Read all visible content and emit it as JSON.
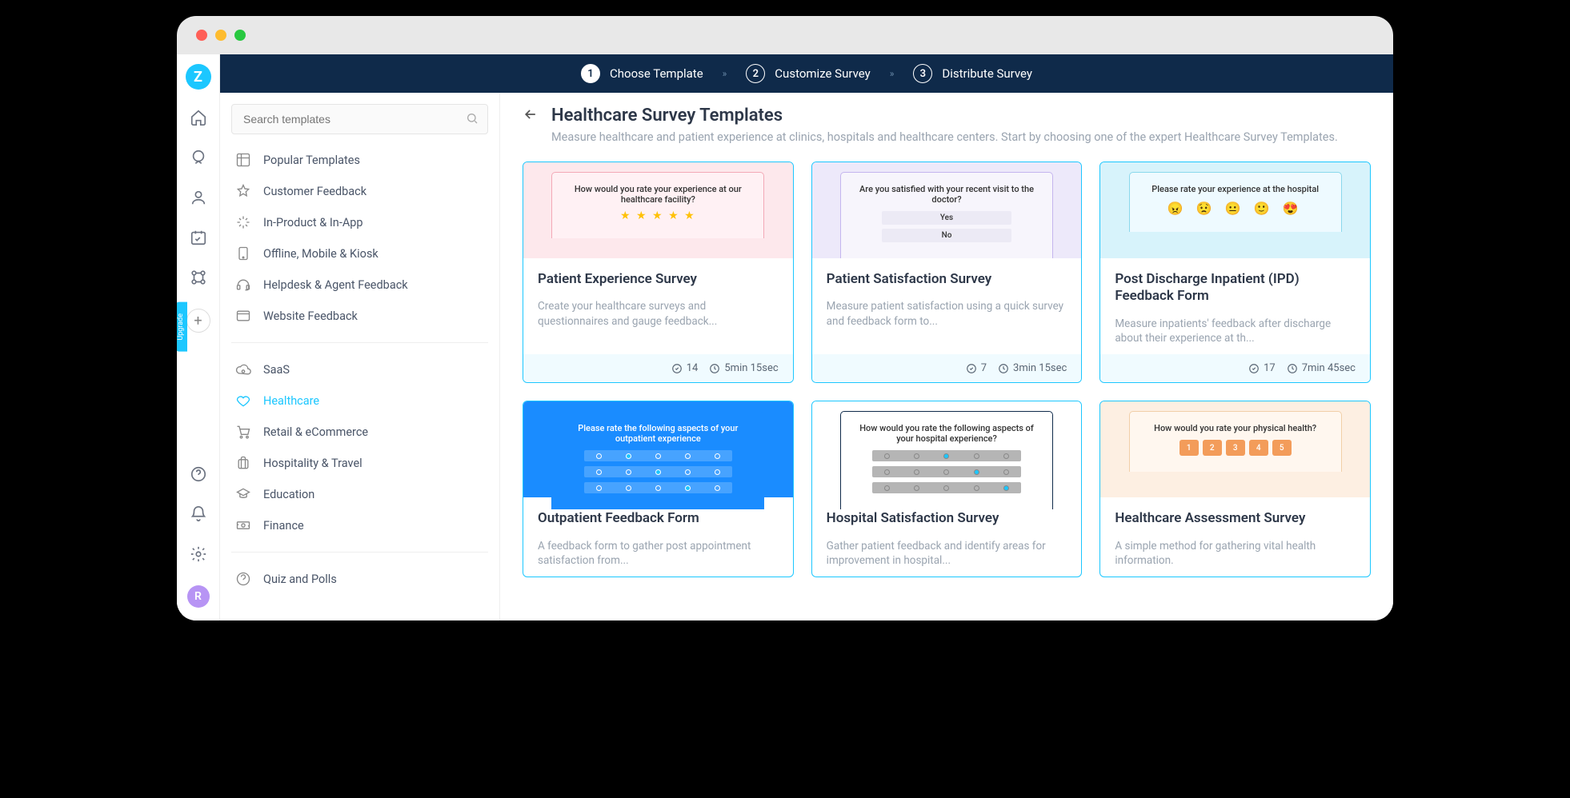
{
  "stepper": {
    "steps": [
      {
        "num": "1",
        "label": "Choose Template",
        "active": true
      },
      {
        "num": "2",
        "label": "Customize Survey",
        "active": false
      },
      {
        "num": "3",
        "label": "Distribute Survey",
        "active": false
      }
    ]
  },
  "search": {
    "placeholder": "Search templates"
  },
  "categories_top": [
    {
      "label": "Popular Templates",
      "icon": "grid"
    },
    {
      "label": "Customer Feedback",
      "icon": "star"
    },
    {
      "label": "In-Product & In-App",
      "icon": "sparkle"
    },
    {
      "label": "Offline, Mobile & Kiosk",
      "icon": "tablet"
    },
    {
      "label": "Helpdesk & Agent Feedback",
      "icon": "headset"
    },
    {
      "label": "Website Feedback",
      "icon": "browser"
    }
  ],
  "categories_mid": [
    {
      "label": "SaaS",
      "icon": "cloud"
    },
    {
      "label": "Healthcare",
      "icon": "heart",
      "active": true
    },
    {
      "label": "Retail & eCommerce",
      "icon": "cart"
    },
    {
      "label": "Hospitality & Travel",
      "icon": "suitcase"
    },
    {
      "label": "Education",
      "icon": "grad"
    },
    {
      "label": "Finance",
      "icon": "money"
    }
  ],
  "categories_bot": [
    {
      "label": "Quiz and Polls",
      "icon": "quiz"
    }
  ],
  "page": {
    "title": "Healthcare Survey Templates",
    "description": "Measure healthcare and patient experience at clinics, hospitals and healthcare centers. Start by choosing one of the expert Healthcare Survey Templates."
  },
  "cards": [
    {
      "title": "Patient Experience Survey",
      "desc": "Create your healthcare surveys and questionnaires and gauge feedback...",
      "count": "14",
      "time": "5min 15sec",
      "preview": {
        "type": "stars",
        "prompt": "How would you rate your experience at our healthcare facility?",
        "bg": "#fde8ec",
        "inner": "#fff1f4",
        "border": "#f3a9b7"
      }
    },
    {
      "title": "Patient Satisfaction Survey",
      "desc": "Measure patient satisfaction using a quick survey and feedback form to...",
      "count": "7",
      "time": "3min 15sec",
      "preview": {
        "type": "yesno",
        "prompt": "Are you satisfied with your recent visit to the doctor?",
        "bg": "#ede9fa",
        "inner": "#f7f5fc",
        "border": "#c4b5ee"
      }
    },
    {
      "title": "Post Discharge Inpatient (IPD) Feedback Form",
      "desc": "Measure inpatients' feedback after discharge about their experience at th...",
      "count": "17",
      "time": "7min 45sec",
      "preview": {
        "type": "emojis",
        "prompt": "Please rate your experience at the hospital",
        "bg": "#d7f3fb",
        "inner": "#eefaff",
        "border": "#8ad8ec"
      }
    },
    {
      "title": "Outpatient Feedback Form",
      "desc": "A feedback form to gather post appointment satisfaction from...",
      "count": "",
      "time": "",
      "preview": {
        "type": "likert-light",
        "prompt": "Please rate the following aspects of your outpatient experience",
        "bg": "#1a8cff",
        "inner": "#1a8cff",
        "border": "#1a8cff",
        "txtcolor": "#fff"
      }
    },
    {
      "title": "Hospital Satisfaction Survey",
      "desc": "Gather patient feedback and identify areas for improvement in hospital...",
      "count": "",
      "time": "",
      "preview": {
        "type": "likert-dark",
        "prompt": "How would you rate the following aspects of your hospital experience?",
        "bg": "#ffffff",
        "inner": "#ffffff",
        "border": "#0f2a4a"
      }
    },
    {
      "title": "Healthcare Assessment Survey",
      "desc": "A simple method for gathering vital health information.",
      "count": "",
      "time": "",
      "preview": {
        "type": "nums",
        "prompt": "How would you rate your physical health?",
        "bg": "#fdefe2",
        "inner": "#fff7ef",
        "border": "#f1cfa8"
      }
    }
  ],
  "avatar": "R",
  "yesno": {
    "yes": "Yes",
    "no": "No"
  }
}
